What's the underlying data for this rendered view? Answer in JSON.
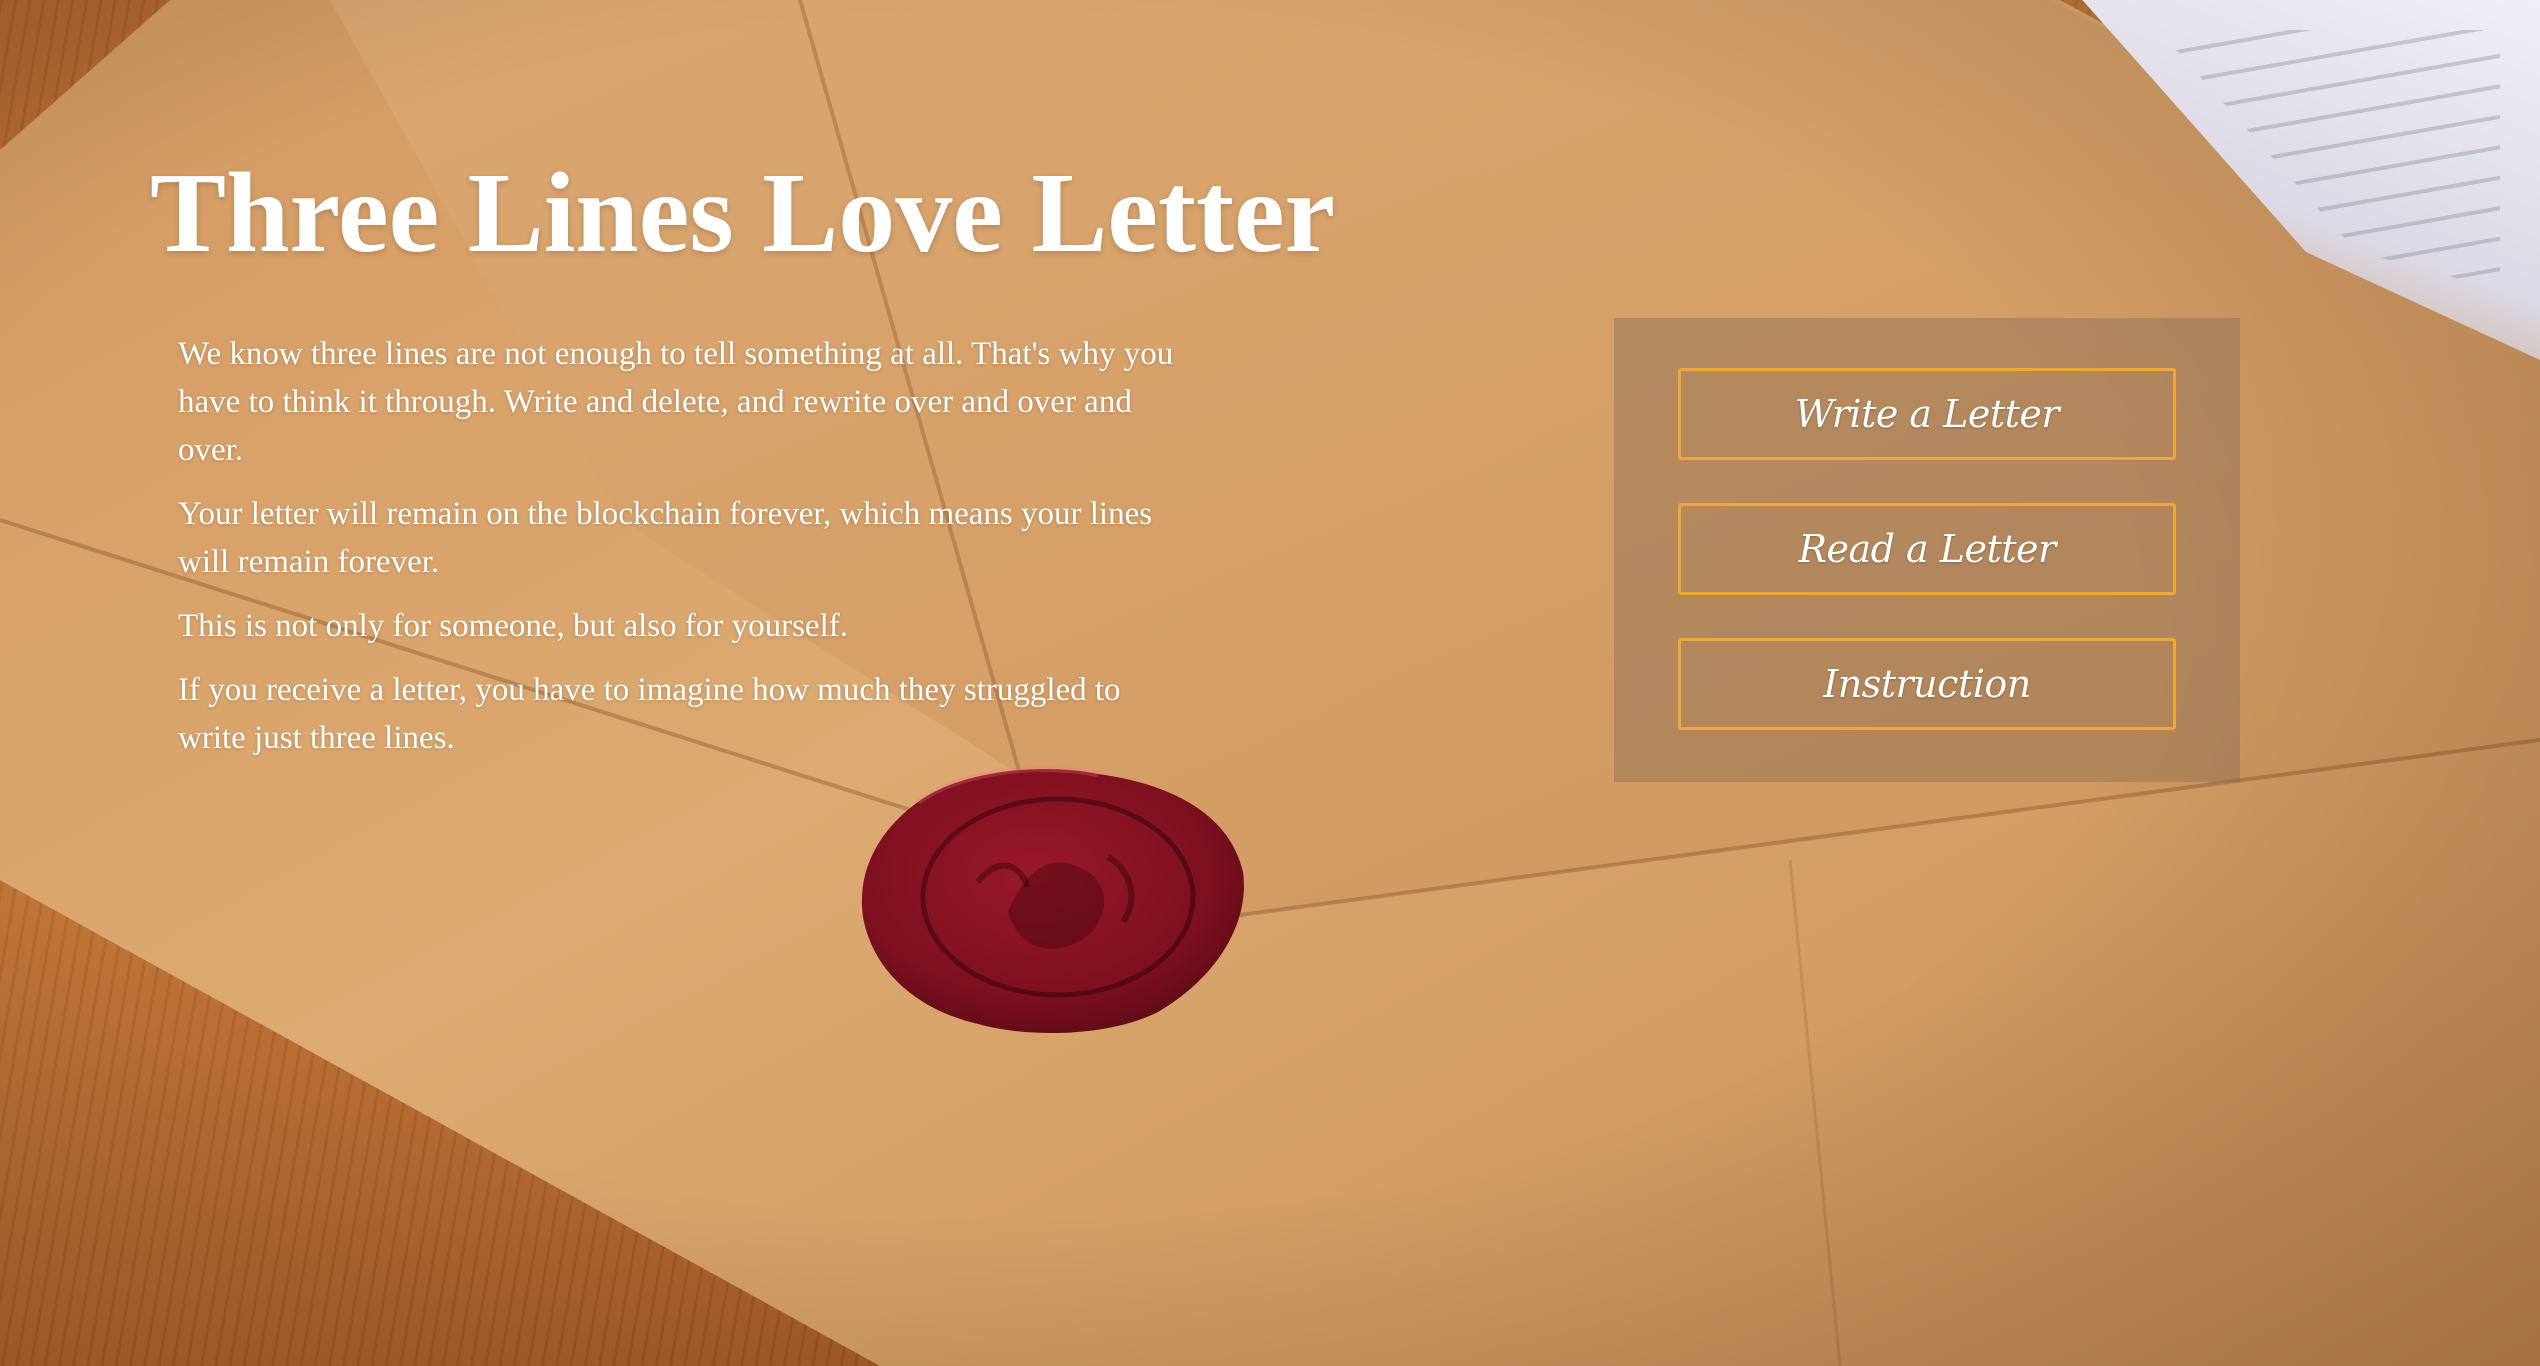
{
  "page": {
    "title": "Three Lines Love Letter",
    "paragraphs": [
      "We know three lines are not enough to tell something at all. That's why you have to think it through. Write and delete, and rewrite over and over and over.",
      "Your letter will remain on the blockchain forever, which means your lines will remain forever.",
      "This is not only for someone, but also for yourself.",
      "If you receive a letter, you have to imagine how much they struggled to write just three lines."
    ]
  },
  "menu": {
    "write_label": "Write a Letter",
    "read_label": "Read a Letter",
    "instruction_label": "Instruction"
  },
  "colors": {
    "button_border": "#efa63a",
    "text": "#ffffff",
    "panel": "rgba(140,110,85,0.45)",
    "envelope": "#d9a56d",
    "wax_seal": "#7e1020"
  }
}
